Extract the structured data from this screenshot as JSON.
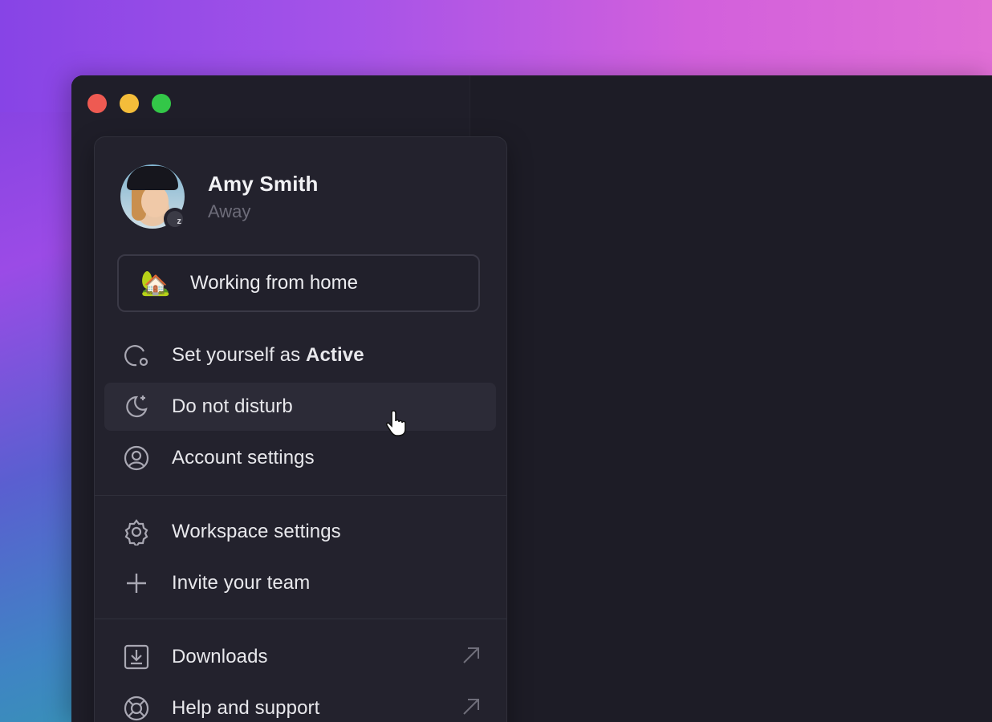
{
  "window": {
    "controls": [
      "close",
      "minimize",
      "maximize"
    ]
  },
  "profile": {
    "name": "Amy Smith",
    "status": "Away",
    "badge": "z"
  },
  "custom_status": {
    "emoji": "🏡",
    "text": "Working from home"
  },
  "menu": {
    "set_active_prefix": "Set yourself as ",
    "set_active_bold": "Active",
    "dnd": "Do not disturb",
    "account": "Account settings",
    "workspace": "Workspace settings",
    "invite": "Invite your team",
    "downloads": "Downloads",
    "help": "Help and support"
  },
  "icons": {
    "set_active": "status-circle-icon",
    "dnd": "moon-icon",
    "account": "user-circle-icon",
    "workspace": "gear-icon",
    "invite": "plus-icon",
    "downloads": "download-icon",
    "help": "lifebuoy-icon",
    "external": "external-arrow-icon"
  },
  "colors": {
    "close": "#ee5a52",
    "minimize": "#f4bd3a",
    "maximize": "#33c748",
    "menu_bg": "#23222d",
    "hover_bg": "#2c2b37"
  }
}
